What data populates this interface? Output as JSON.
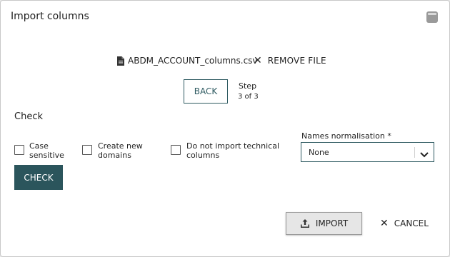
{
  "dialog": {
    "title": "Import columns"
  },
  "file": {
    "name": "ABDM_ACCOUNT_columns.csv",
    "remove_label": "REMOVE FILE"
  },
  "wizard": {
    "back_label": "BACK",
    "step_label": "Step",
    "step_count": "3 of 3"
  },
  "check_section": {
    "title": "Check",
    "options": [
      {
        "label_line1": "Case",
        "label_line2": "sensitive",
        "checked": false
      },
      {
        "label_line1": "Create new",
        "label_line2": "domains",
        "checked": false
      },
      {
        "label_line1": "Do not import technical",
        "label_line2": "columns",
        "checked": false
      }
    ],
    "names_normalisation": {
      "label": "Names normalisation *",
      "value": "None"
    },
    "check_label": "CHECK"
  },
  "footer": {
    "import_label": "IMPORT",
    "cancel_label": "CANCEL"
  },
  "colors": {
    "accent": "#2b555c",
    "border_accent": "#2f5b62"
  },
  "icons": {
    "window": "window-minimize-icon",
    "file": "file-icon",
    "remove": "close-icon",
    "chevron": "chevron-down-icon",
    "upload": "upload-icon",
    "cancel": "close-icon"
  }
}
